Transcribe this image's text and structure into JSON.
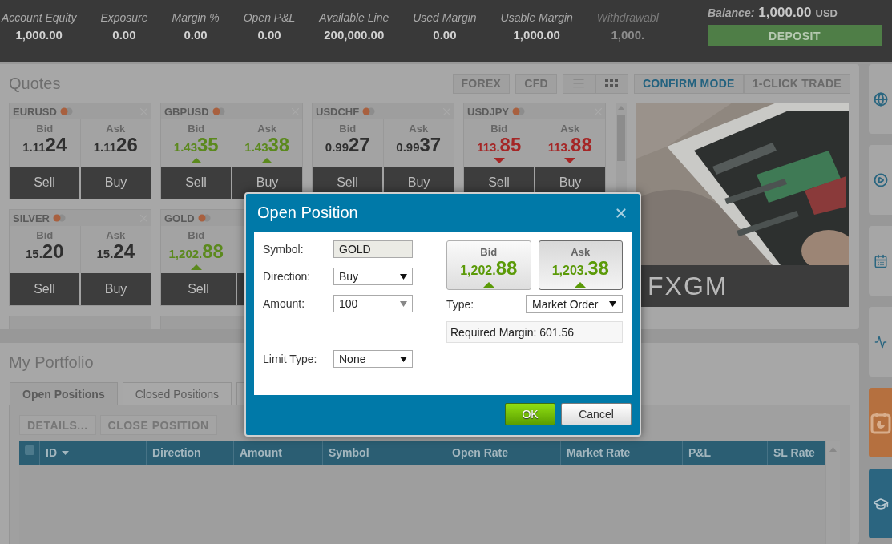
{
  "top_bar": {
    "metrics": [
      {
        "label": "Account Equity",
        "value": "1,000.00",
        "faded": false
      },
      {
        "label": "Exposure",
        "value": "0.00",
        "faded": false
      },
      {
        "label": "Margin %",
        "value": "0.00",
        "faded": false
      },
      {
        "label": "Open P&L",
        "value": "0.00",
        "faded": false
      },
      {
        "label": "Available Line",
        "value": "200,000.00",
        "faded": false
      },
      {
        "label": "Used Margin",
        "value": "0.00",
        "faded": false
      },
      {
        "label": "Usable Margin",
        "value": "1,000.00",
        "faded": false
      },
      {
        "label": "Withdrawabl",
        "value": "1,000.",
        "faded": true
      }
    ],
    "balance": {
      "label": "Balance:",
      "value": "1,000.00",
      "currency": "USD"
    },
    "deposit_button": "DEPOSIT"
  },
  "quotes": {
    "title": "Quotes",
    "filters": [
      "FOREX",
      "CFD"
    ],
    "views": [
      {
        "kind": "list",
        "selected": false
      },
      {
        "kind": "grid",
        "selected": true
      }
    ],
    "modes": [
      {
        "label": "CONFIRM MODE",
        "selected": true
      },
      {
        "label": "1-CLICK TRADE",
        "selected": false
      }
    ],
    "tiles": [
      {
        "symbol": "EURUSD",
        "bid": {
          "label": "Bid",
          "small": "1.11",
          "big": "24",
          "up": false,
          "down": false
        },
        "ask": {
          "label": "Ask",
          "small": "1.11",
          "big": "26",
          "up": false,
          "down": false
        },
        "sell": "Sell",
        "buy": "Buy"
      },
      {
        "symbol": "GBPUSD",
        "bid": {
          "label": "Bid",
          "small": "1.43",
          "big": "35",
          "up": true,
          "down": false
        },
        "ask": {
          "label": "Ask",
          "small": "1.43",
          "big": "38",
          "up": true,
          "down": false
        },
        "sell": "Sell",
        "buy": "Buy"
      },
      {
        "symbol": "USDCHF",
        "bid": {
          "label": "Bid",
          "small": "0.99",
          "big": "27",
          "up": false,
          "down": false
        },
        "ask": {
          "label": "Ask",
          "small": "0.99",
          "big": "37",
          "up": false,
          "down": false
        },
        "sell": "Sell",
        "buy": "Buy"
      },
      {
        "symbol": "USDJPY",
        "bid": {
          "label": "Bid",
          "small": "113.",
          "big": "85",
          "up": false,
          "down": true
        },
        "ask": {
          "label": "Ask",
          "small": "113.",
          "big": "88",
          "up": false,
          "down": true
        },
        "sell": "Sell",
        "buy": "Buy"
      },
      {
        "symbol": "SILVER",
        "bid": {
          "label": "Bid",
          "small": "15.",
          "big": "20",
          "up": false,
          "down": false
        },
        "ask": {
          "label": "Ask",
          "small": "15.",
          "big": "24",
          "up": false,
          "down": false
        },
        "sell": "Sell",
        "buy": "Buy"
      },
      {
        "symbol": "GOLD",
        "bid": {
          "label": "Bid",
          "small": "1,202.",
          "big": "88",
          "up": true,
          "down": false
        },
        "sell": "Sell"
      }
    ],
    "banner": {
      "logo": "FXGM"
    }
  },
  "portfolio": {
    "title": "My Portfolio",
    "tabs": [
      {
        "label": "Open Positions",
        "selected": true
      },
      {
        "label": "Closed Positions",
        "selected": false
      }
    ],
    "actions": [
      {
        "label": "DETAILS...",
        "disabled": true
      },
      {
        "label": "CLOSE POSITION",
        "disabled": true
      }
    ],
    "table": {
      "select_all_checked": false,
      "columns": [
        "ID",
        "Direction",
        "Amount",
        "Symbol",
        "Open Rate",
        "Market Rate",
        "P&L",
        "SL Rate"
      ]
    }
  },
  "side_buttons": [
    {
      "kind": "globe"
    },
    {
      "kind": "play"
    },
    {
      "kind": "calendar"
    },
    {
      "kind": "pulse"
    },
    {
      "kind": "report"
    },
    {
      "kind": "education"
    }
  ],
  "dialog": {
    "title": "Open Position",
    "fields": [
      {
        "label": "Symbol:",
        "value": "GOLD",
        "kind": "readonly"
      },
      {
        "label": "Direction:",
        "value": "Buy",
        "kind": "select"
      },
      {
        "label": "Amount:",
        "value": "100",
        "kind": "combo"
      },
      {
        "label": "Limit Type:",
        "value": "None",
        "kind": "select"
      }
    ],
    "prices": [
      {
        "label": "Bid",
        "small": "1,202.",
        "big": "88",
        "selected": false
      },
      {
        "label": "Ask",
        "small": "1,203.",
        "big": "38",
        "selected": true
      }
    ],
    "order_type": {
      "label": "Type:",
      "value": "Market Order"
    },
    "required_margin": "Required Margin: 601.56",
    "buttons": [
      {
        "label": "OK",
        "kind": "primary"
      },
      {
        "label": "Cancel",
        "kind": "secondary"
      }
    ]
  }
}
